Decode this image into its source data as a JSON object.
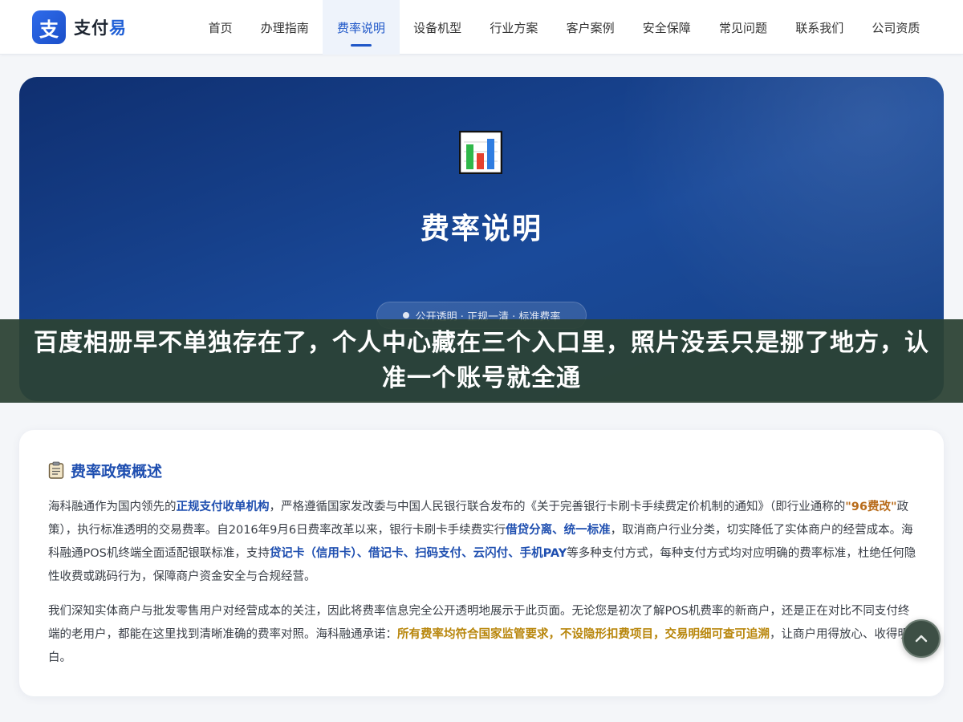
{
  "brand": {
    "mark": "支",
    "name_prefix": "支付",
    "name_accent": "易"
  },
  "nav": {
    "items": [
      {
        "label": "首页"
      },
      {
        "label": "办理指南"
      },
      {
        "label": "费率说明",
        "active": true
      },
      {
        "label": "设备机型"
      },
      {
        "label": "行业方案"
      },
      {
        "label": "客户案例"
      },
      {
        "label": "安全保障"
      },
      {
        "label": "常见问题"
      },
      {
        "label": "联系我们"
      },
      {
        "label": "公司资质"
      }
    ]
  },
  "hero": {
    "icon": "bar-chart-icon",
    "title": "费率说明",
    "badge": "公开透明 · 正规一清 · 标准费率"
  },
  "overlay": {
    "text": "百度相册早不单独存在了，个人中心藏在三个入口里，照片没丢只是挪了地方，认准一个账号就全通"
  },
  "section": {
    "icon": "clipboard-icon",
    "title": "费率政策概述",
    "p1": {
      "t1": "海科融通作为国内领先的",
      "h1": "正规支付收单机构",
      "t2": "，严格遵循国家发改委与中国人民银行联合发布的《关于完善银行卡刷卡手续费定价机制的通知》（即行业通称的",
      "h2": "\"96费改\"",
      "t3": "政策），执行标准透明的交易费率。自2016年9月6日费率改革以来，银行卡刷卡手续费实行",
      "h3": "借贷分离、统一标准",
      "t4": "，取消商户行业分类，切实降低了实体商户的经营成本。海科融通POS机终端全面适配银联标准，支持",
      "h4": "贷记卡（信用卡）、借记卡、扫码支付、云闪付、手机PAY",
      "t5": "等多种支付方式，每种支付方式均对应明确的费率标准，杜绝任何隐性收费或跳码行为，保障商户资金安全与合规经营。"
    },
    "p2": {
      "t1": "我们深知实体商户与批发零售用户对经营成本的关注，因此将费率信息完全公开透明地展示于此页面。无论您是初次了解POS机费率的新商户，还是正在对比不同支付终端的老用户，都能在这里找到清晰准确的费率对照。海科融通承诺：",
      "h1": "所有费率均符合国家监管要求，不设隐形扣费项目，交易明细可查可追溯",
      "t2": "，让商户用得放心、收得明白。"
    }
  },
  "back_to_top": {
    "icon": "chevron-up-icon"
  },
  "colors": {
    "brand_blue": "#1f57c8",
    "hero_dark": "#0f2f70",
    "highlight_blue": "#1f4fb0",
    "highlight_orange": "#b86b1a",
    "highlight_gold": "#b8860b",
    "overlay_green": "#2c4234"
  }
}
